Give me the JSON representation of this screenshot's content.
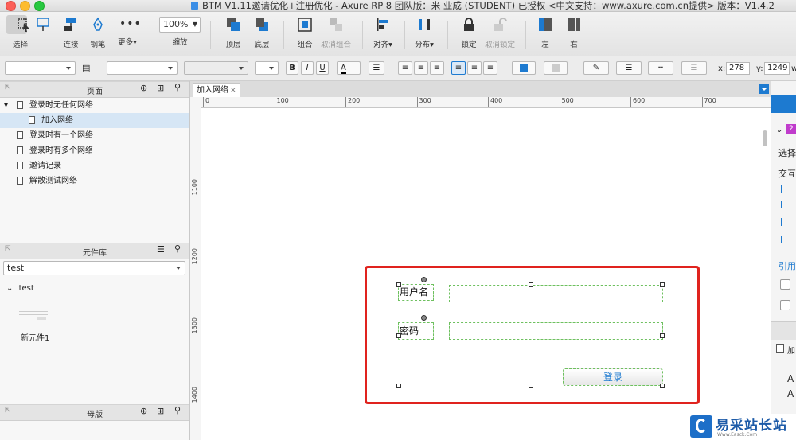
{
  "window": {
    "title": "BTM V1.11邀请优化+注册优化 - Axure RP 8 团队版：米 业成 (STUDENT) 已授权    <中文支持：www.axure.com.cn提供> 版本：V1.4.2"
  },
  "toolbar": {
    "select_label": "选择",
    "connect_label": "连接",
    "pen_label": "钢笔",
    "more_label": "更多",
    "zoom_value": "100%",
    "zoom_label": "缩放",
    "top_label": "顶层",
    "bottom_label": "底层",
    "group_label": "组合",
    "ungroup_label": "取消组合",
    "align_label": "对齐",
    "distribute_label": "分布",
    "lock_label": "锁定",
    "unlock_label": "取消锁定",
    "left_label": "左",
    "right_label": "右"
  },
  "format": {
    "x_label": "x:",
    "x_value": "278",
    "y_label": "y:",
    "y_value": "1249",
    "w_label": "w:",
    "bold": "B",
    "italic": "I",
    "underline": "U",
    "font_color": "A"
  },
  "pages_panel": {
    "title": "页面",
    "items": [
      {
        "label": "登录时无任何网络",
        "level": 0
      },
      {
        "label": "加入网络",
        "level": 1,
        "selected": true
      },
      {
        "label": "登录时有一个网络",
        "level": 0
      },
      {
        "label": "登录时有多个网络",
        "level": 0
      },
      {
        "label": "邀请记录",
        "level": 0
      },
      {
        "label": "解散测试网络",
        "level": 0
      }
    ]
  },
  "library_panel": {
    "title": "元件库",
    "selected_library": "test",
    "group_label": "test",
    "widget_label": "新元件1"
  },
  "masters_panel": {
    "title": "母版"
  },
  "canvas": {
    "tab_label": "加入网络",
    "tab_close": "×",
    "ruler_h": [
      "0",
      "100",
      "200",
      "300",
      "400",
      "500",
      "600",
      "700"
    ],
    "ruler_v": [
      "1100",
      "1200",
      "1300",
      "1400"
    ],
    "form": {
      "username_label": "用户名",
      "password_label": "密码",
      "login_button": "登录"
    }
  },
  "right_panel": {
    "select_text": "选择",
    "interaction_text": "交互",
    "reference_text": "引用",
    "item_label": "加",
    "badge_num": "2",
    "letters": [
      "A",
      "A"
    ]
  },
  "watermark": {
    "text": "易采站长站",
    "sub": "Www.Easck.Com"
  },
  "colors": {
    "highlight_red": "#e0231e",
    "selection_green": "#6ec05f",
    "accent_blue": "#1d7ad0",
    "badge_magenta": "#c03ccc"
  }
}
